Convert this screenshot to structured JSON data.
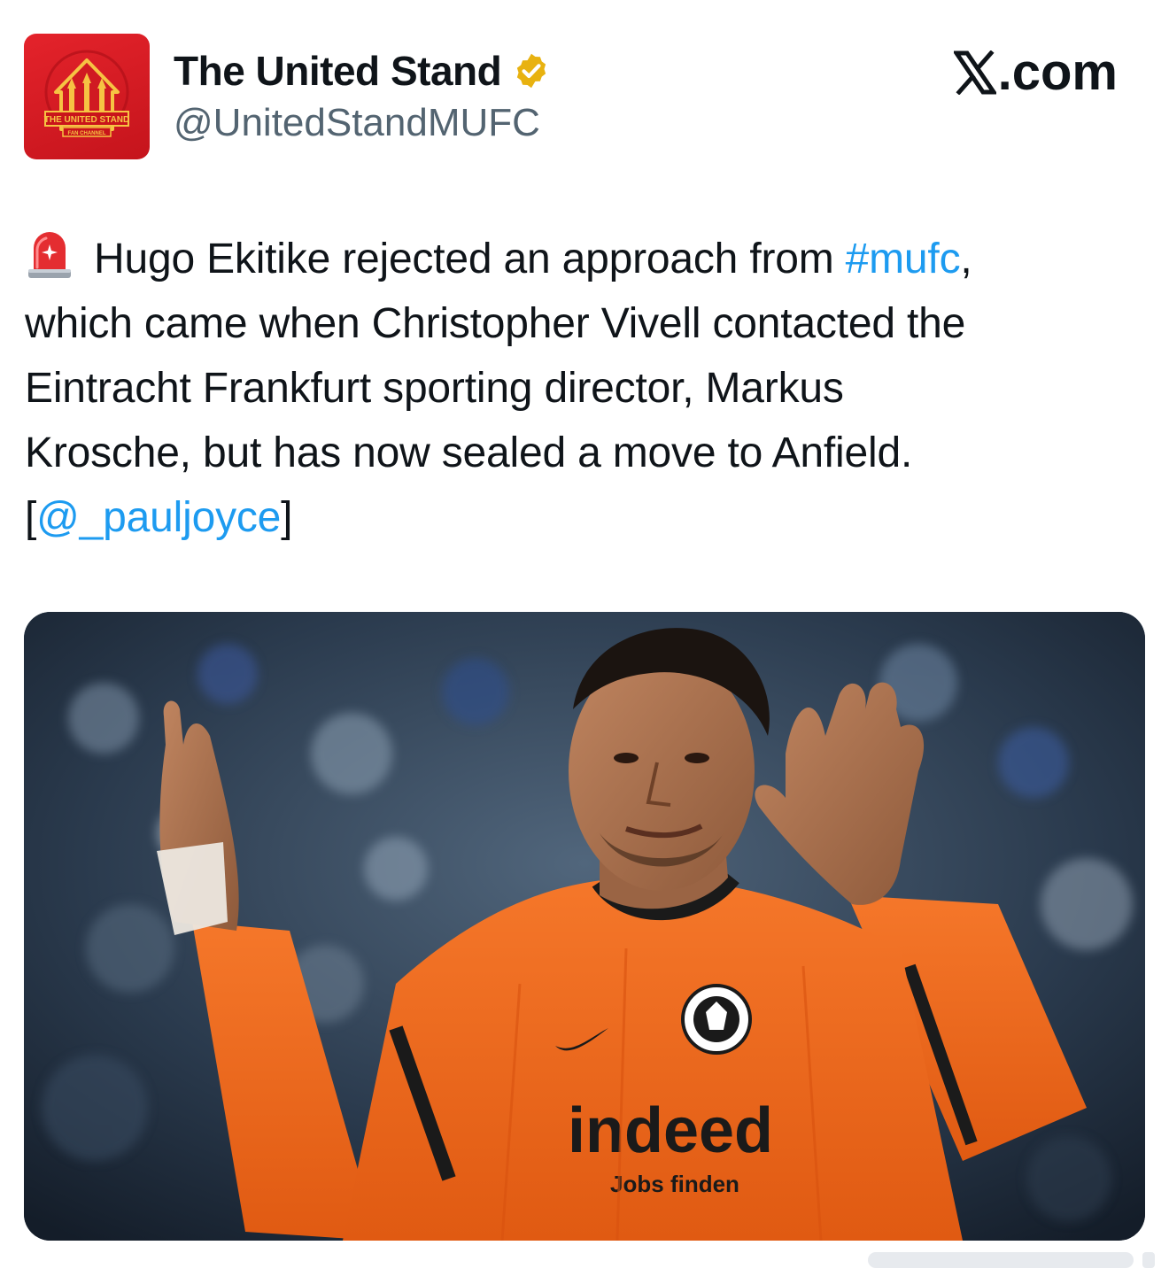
{
  "post": {
    "author": {
      "display_name": "The United Stand",
      "handle": "@UnitedStandMUFC",
      "verified": true,
      "verified_badge_color": "#e8b210",
      "avatar": {
        "icon": "team-crest-icon",
        "background_color": "#d81b22",
        "logo_text": "THE UNITED STAND",
        "logo_subtext": "FAN CHANNEL"
      }
    },
    "platform": {
      "name": "X.com",
      "letter": "X",
      "suffix": ".com"
    },
    "text": {
      "emoji": "siren-icon",
      "segments": [
        {
          "text": "Hugo Ekitike rejected an approach from ",
          "type": "text"
        },
        {
          "text": "#mufc",
          "type": "hashtag"
        },
        {
          "text": ",",
          "type": "text"
        },
        {
          "text": "which came when Christopher Vivell contacted the",
          "type": "text"
        },
        {
          "text": "Eintracht Frankfurt sporting director, Markus",
          "type": "text"
        },
        {
          "text": "Krosche, but has now sealed a move to Anfield.",
          "type": "text"
        },
        {
          "text": "[",
          "type": "text"
        },
        {
          "text": "@_pauljoyce",
          "type": "mention"
        },
        {
          "text": "]",
          "type": "text"
        }
      ]
    },
    "media": {
      "kind": "photo",
      "description_icon": "football-player-photo",
      "shirt_sponsor": "indeed",
      "shirt_sponsor_tagline": "Jobs finden",
      "shirt_color": "#f26a1b"
    },
    "colors": {
      "text": "#0f1419",
      "secondary_text": "#536471",
      "link": "#1d9bf0"
    }
  }
}
